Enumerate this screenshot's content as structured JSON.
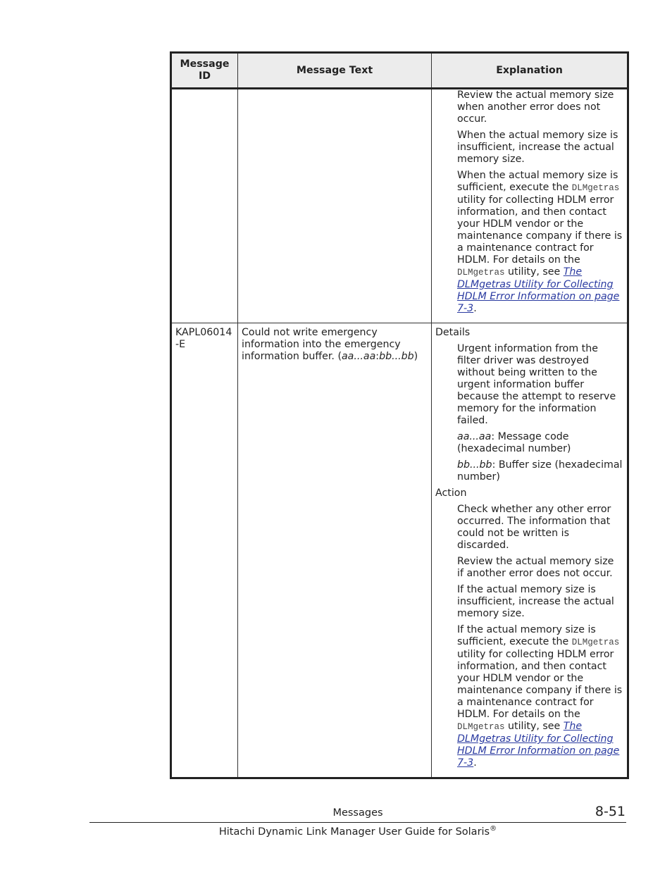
{
  "table": {
    "headers": [
      "Message ID",
      "Message Text",
      "Explanation"
    ],
    "continued_row": {
      "paragraphs": [
        "Review the actual memory size when another error does not occur.",
        "When the actual memory size is insufficient, increase the actual memory size."
      ],
      "last_para": {
        "pre": "When the actual memory size is sufficient, execute the ",
        "code1": "DLMgetras",
        "mid": " utility for collecting HDLM error information, and then contact your HDLM vendor or the maintenance company if there is a maintenance contract for HDLM. For details on the ",
        "code2": "DLMgetras",
        "post": " utility, see ",
        "link": "The DLMgetras Utility for Collecting HDLM Error Information on page 7-3",
        "end": "."
      }
    },
    "row": {
      "id": "KAPL06014-E",
      "text_pre": "Could not write emergency information into the emergency information buffer. (",
      "text_var1": "aa...aa",
      "text_sep": ":",
      "text_var2": "bb...bb",
      "text_post": ")",
      "details_label": "Details",
      "details_para": "Urgent information from the filter driver was destroyed without being written to the urgent information buffer because the attempt to reserve memory for the information failed.",
      "var1_name": "aa...aa",
      "var1_desc": ": Message code (hexadecimal number)",
      "var2_name": "bb...bb",
      "var2_desc": ": Buffer size (hexadecimal number)",
      "action_label": "Action",
      "action_paras": [
        "Check whether any other error occurred. The information that could not be written is discarded.",
        "Review the actual memory size if another error does not occur.",
        "If the actual memory size is insufficient, increase the actual memory size."
      ],
      "last_para": {
        "pre": "If the actual memory size is sufficient, execute the ",
        "code1": "DLMgetras",
        "mid": " utility for collecting HDLM error information, and then contact your HDLM vendor or the maintenance company if there is a maintenance contract for HDLM. For details on the ",
        "code2": "DLMgetras",
        "post": " utility, see ",
        "link": "The DLMgetras Utility for Collecting HDLM Error Information on page 7-3",
        "end": "."
      }
    }
  },
  "footer": {
    "section": "Messages",
    "page_number": "8-51",
    "title": "Hitachi Dynamic Link Manager User Guide for Solaris",
    "title_sup": "®"
  }
}
